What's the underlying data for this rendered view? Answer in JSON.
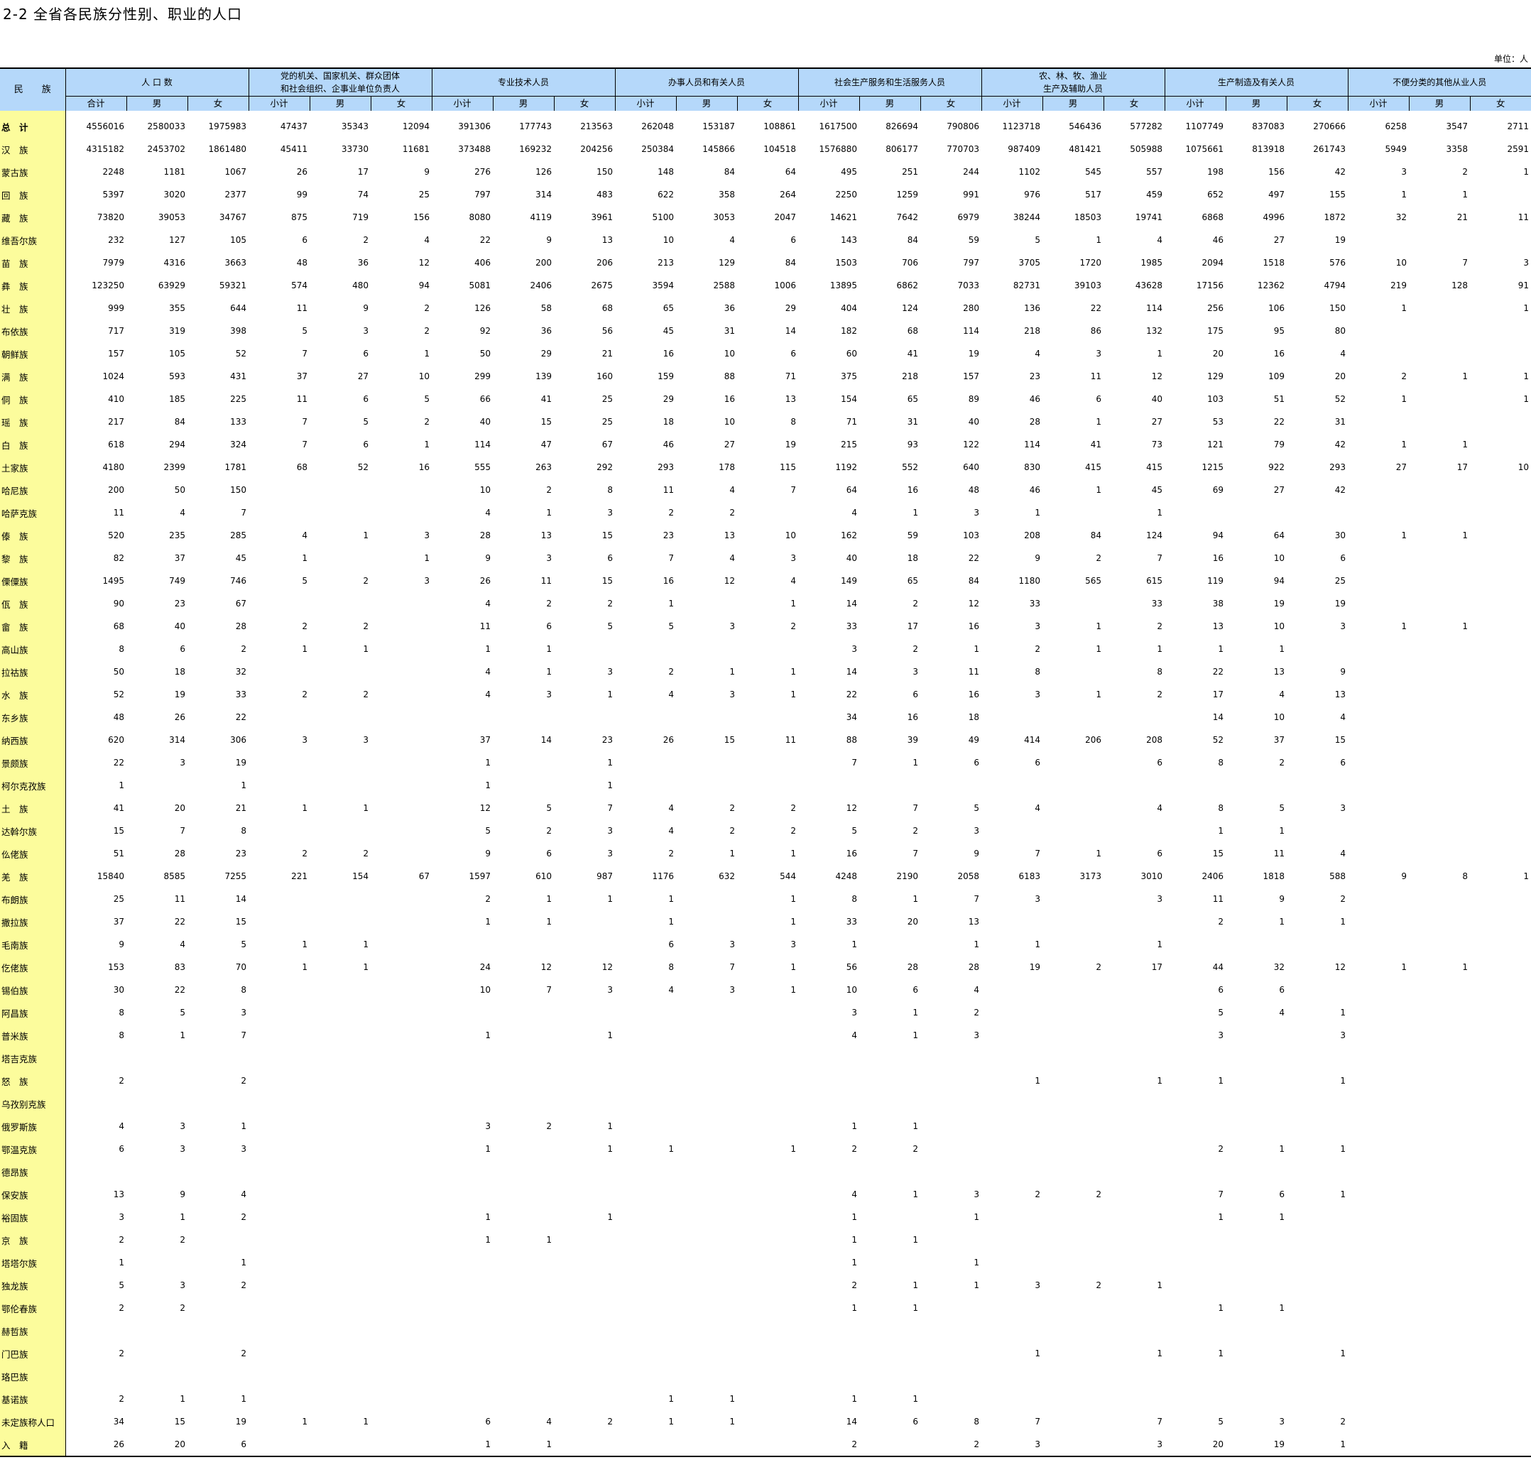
{
  "title": "2-2  全省各民族分性别、职业的人口",
  "unit": "单位：人",
  "header": {
    "row_label": "民　　族",
    "groups": [
      "人 口 数",
      "党的机关、国家机关、群众团体\n和社会组织、企事业单位负责人",
      "专业技术人员",
      "办事人员和有关人员",
      "社会生产服务和生活服务人员",
      "农、林、牧、渔业\n生产及辅助人员",
      "生产制造及有关人员",
      "不便分类的其他从业人员"
    ],
    "sub": [
      "合计",
      "男",
      "女",
      "小计",
      "男",
      "女",
      "小计",
      "男",
      "女",
      "小计",
      "男",
      "女",
      "小计",
      "男",
      "女",
      "小计",
      "男",
      "女",
      "小计",
      "男",
      "女",
      "小计",
      "男",
      "女"
    ]
  },
  "rows": [
    [
      "总　计",
      "4556016",
      "2580033",
      "1975983",
      "47437",
      "35343",
      "12094",
      "391306",
      "177743",
      "213563",
      "262048",
      "153187",
      "108861",
      "1617500",
      "826694",
      "790806",
      "1123718",
      "546436",
      "577282",
      "1107749",
      "837083",
      "270666",
      "6258",
      "3547",
      "2711"
    ],
    [
      "汉　族",
      "4315182",
      "2453702",
      "1861480",
      "45411",
      "33730",
      "11681",
      "373488",
      "169232",
      "204256",
      "250384",
      "145866",
      "104518",
      "1576880",
      "806177",
      "770703",
      "987409",
      "481421",
      "505988",
      "1075661",
      "813918",
      "261743",
      "5949",
      "3358",
      "2591"
    ],
    [
      "蒙古族",
      "2248",
      "1181",
      "1067",
      "26",
      "17",
      "9",
      "276",
      "126",
      "150",
      "148",
      "84",
      "64",
      "495",
      "251",
      "244",
      "1102",
      "545",
      "557",
      "198",
      "156",
      "42",
      "3",
      "2",
      "1"
    ],
    [
      "回　族",
      "5397",
      "3020",
      "2377",
      "99",
      "74",
      "25",
      "797",
      "314",
      "483",
      "622",
      "358",
      "264",
      "2250",
      "1259",
      "991",
      "976",
      "517",
      "459",
      "652",
      "497",
      "155",
      "1",
      "1",
      ""
    ],
    [
      "藏　族",
      "73820",
      "39053",
      "34767",
      "875",
      "719",
      "156",
      "8080",
      "4119",
      "3961",
      "5100",
      "3053",
      "2047",
      "14621",
      "7642",
      "6979",
      "38244",
      "18503",
      "19741",
      "6868",
      "4996",
      "1872",
      "32",
      "21",
      "11"
    ],
    [
      "维吾尔族",
      "232",
      "127",
      "105",
      "6",
      "2",
      "4",
      "22",
      "9",
      "13",
      "10",
      "4",
      "6",
      "143",
      "84",
      "59",
      "5",
      "1",
      "4",
      "46",
      "27",
      "19",
      "",
      "",
      ""
    ],
    [
      "苗　族",
      "7979",
      "4316",
      "3663",
      "48",
      "36",
      "12",
      "406",
      "200",
      "206",
      "213",
      "129",
      "84",
      "1503",
      "706",
      "797",
      "3705",
      "1720",
      "1985",
      "2094",
      "1518",
      "576",
      "10",
      "7",
      "3"
    ],
    [
      "彝　族",
      "123250",
      "63929",
      "59321",
      "574",
      "480",
      "94",
      "5081",
      "2406",
      "2675",
      "3594",
      "2588",
      "1006",
      "13895",
      "6862",
      "7033",
      "82731",
      "39103",
      "43628",
      "17156",
      "12362",
      "4794",
      "219",
      "128",
      "91"
    ],
    [
      "壮　族",
      "999",
      "355",
      "644",
      "11",
      "9",
      "2",
      "126",
      "58",
      "68",
      "65",
      "36",
      "29",
      "404",
      "124",
      "280",
      "136",
      "22",
      "114",
      "256",
      "106",
      "150",
      "1",
      "",
      "1"
    ],
    [
      "布依族",
      "717",
      "319",
      "398",
      "5",
      "3",
      "2",
      "92",
      "36",
      "56",
      "45",
      "31",
      "14",
      "182",
      "68",
      "114",
      "218",
      "86",
      "132",
      "175",
      "95",
      "80",
      "",
      "",
      ""
    ],
    [
      "朝鲜族",
      "157",
      "105",
      "52",
      "7",
      "6",
      "1",
      "50",
      "29",
      "21",
      "16",
      "10",
      "6",
      "60",
      "41",
      "19",
      "4",
      "3",
      "1",
      "20",
      "16",
      "4",
      "",
      "",
      ""
    ],
    [
      "满　族",
      "1024",
      "593",
      "431",
      "37",
      "27",
      "10",
      "299",
      "139",
      "160",
      "159",
      "88",
      "71",
      "375",
      "218",
      "157",
      "23",
      "11",
      "12",
      "129",
      "109",
      "20",
      "2",
      "1",
      "1"
    ],
    [
      "侗　族",
      "410",
      "185",
      "225",
      "11",
      "6",
      "5",
      "66",
      "41",
      "25",
      "29",
      "16",
      "13",
      "154",
      "65",
      "89",
      "46",
      "6",
      "40",
      "103",
      "51",
      "52",
      "1",
      "",
      "1"
    ],
    [
      "瑶　族",
      "217",
      "84",
      "133",
      "7",
      "5",
      "2",
      "40",
      "15",
      "25",
      "18",
      "10",
      "8",
      "71",
      "31",
      "40",
      "28",
      "1",
      "27",
      "53",
      "22",
      "31",
      "",
      "",
      ""
    ],
    [
      "白　族",
      "618",
      "294",
      "324",
      "7",
      "6",
      "1",
      "114",
      "47",
      "67",
      "46",
      "27",
      "19",
      "215",
      "93",
      "122",
      "114",
      "41",
      "73",
      "121",
      "79",
      "42",
      "1",
      "1",
      ""
    ],
    [
      "土家族",
      "4180",
      "2399",
      "1781",
      "68",
      "52",
      "16",
      "555",
      "263",
      "292",
      "293",
      "178",
      "115",
      "1192",
      "552",
      "640",
      "830",
      "415",
      "415",
      "1215",
      "922",
      "293",
      "27",
      "17",
      "10"
    ],
    [
      "哈尼族",
      "200",
      "50",
      "150",
      "",
      "",
      "",
      "10",
      "2",
      "8",
      "11",
      "4",
      "7",
      "64",
      "16",
      "48",
      "46",
      "1",
      "45",
      "69",
      "27",
      "42",
      "",
      "",
      ""
    ],
    [
      "哈萨克族",
      "11",
      "4",
      "7",
      "",
      "",
      "",
      "4",
      "1",
      "3",
      "2",
      "2",
      "",
      "4",
      "1",
      "3",
      "1",
      "",
      "1",
      "",
      "",
      "",
      "",
      "",
      ""
    ],
    [
      "傣　族",
      "520",
      "235",
      "285",
      "4",
      "1",
      "3",
      "28",
      "13",
      "15",
      "23",
      "13",
      "10",
      "162",
      "59",
      "103",
      "208",
      "84",
      "124",
      "94",
      "64",
      "30",
      "1",
      "1",
      ""
    ],
    [
      "黎　族",
      "82",
      "37",
      "45",
      "1",
      "",
      "1",
      "9",
      "3",
      "6",
      "7",
      "4",
      "3",
      "40",
      "18",
      "22",
      "9",
      "2",
      "7",
      "16",
      "10",
      "6",
      "",
      "",
      ""
    ],
    [
      "傈僳族",
      "1495",
      "749",
      "746",
      "5",
      "2",
      "3",
      "26",
      "11",
      "15",
      "16",
      "12",
      "4",
      "149",
      "65",
      "84",
      "1180",
      "565",
      "615",
      "119",
      "94",
      "25",
      "",
      "",
      ""
    ],
    [
      "佤　族",
      "90",
      "23",
      "67",
      "",
      "",
      "",
      "4",
      "2",
      "2",
      "1",
      "",
      "1",
      "14",
      "2",
      "12",
      "33",
      "",
      "33",
      "38",
      "19",
      "19",
      "",
      "",
      ""
    ],
    [
      "畲　族",
      "68",
      "40",
      "28",
      "2",
      "2",
      "",
      "11",
      "6",
      "5",
      "5",
      "3",
      "2",
      "33",
      "17",
      "16",
      "3",
      "1",
      "2",
      "13",
      "10",
      "3",
      "1",
      "1",
      ""
    ],
    [
      "高山族",
      "8",
      "6",
      "2",
      "1",
      "1",
      "",
      "1",
      "1",
      "",
      "",
      "",
      "",
      "3",
      "2",
      "1",
      "2",
      "1",
      "1",
      "1",
      "1",
      "",
      "",
      "",
      ""
    ],
    [
      "拉祜族",
      "50",
      "18",
      "32",
      "",
      "",
      "",
      "4",
      "1",
      "3",
      "2",
      "1",
      "1",
      "14",
      "3",
      "11",
      "8",
      "",
      "8",
      "22",
      "13",
      "9",
      "",
      "",
      ""
    ],
    [
      "水　族",
      "52",
      "19",
      "33",
      "2",
      "2",
      "",
      "4",
      "3",
      "1",
      "4",
      "3",
      "1",
      "22",
      "6",
      "16",
      "3",
      "1",
      "2",
      "17",
      "4",
      "13",
      "",
      "",
      ""
    ],
    [
      "东乡族",
      "48",
      "26",
      "22",
      "",
      "",
      "",
      "",
      "",
      "",
      "",
      "",
      "",
      "34",
      "16",
      "18",
      "",
      "",
      "",
      "14",
      "10",
      "4",
      "",
      "",
      ""
    ],
    [
      "纳西族",
      "620",
      "314",
      "306",
      "3",
      "3",
      "",
      "37",
      "14",
      "23",
      "26",
      "15",
      "11",
      "88",
      "39",
      "49",
      "414",
      "206",
      "208",
      "52",
      "37",
      "15",
      "",
      "",
      ""
    ],
    [
      "景颇族",
      "22",
      "3",
      "19",
      "",
      "",
      "",
      "1",
      "",
      "1",
      "",
      "",
      "",
      "7",
      "1",
      "6",
      "6",
      "",
      "6",
      "8",
      "2",
      "6",
      "",
      "",
      ""
    ],
    [
      "柯尔克孜族",
      "1",
      "",
      "1",
      "",
      "",
      "",
      "1",
      "",
      "1",
      "",
      "",
      "",
      "",
      "",
      "",
      "",
      "",
      "",
      "",
      "",
      "",
      "",
      "",
      ""
    ],
    [
      "土　族",
      "41",
      "20",
      "21",
      "1",
      "1",
      "",
      "12",
      "5",
      "7",
      "4",
      "2",
      "2",
      "12",
      "7",
      "5",
      "4",
      "",
      "4",
      "8",
      "5",
      "3",
      "",
      "",
      ""
    ],
    [
      "达斡尔族",
      "15",
      "7",
      "8",
      "",
      "",
      "",
      "5",
      "2",
      "3",
      "4",
      "2",
      "2",
      "5",
      "2",
      "3",
      "",
      "",
      "",
      "1",
      "1",
      "",
      "",
      "",
      ""
    ],
    [
      "仫佬族",
      "51",
      "28",
      "23",
      "2",
      "2",
      "",
      "9",
      "6",
      "3",
      "2",
      "1",
      "1",
      "16",
      "7",
      "9",
      "7",
      "1",
      "6",
      "15",
      "11",
      "4",
      "",
      "",
      ""
    ],
    [
      "羌　族",
      "15840",
      "8585",
      "7255",
      "221",
      "154",
      "67",
      "1597",
      "610",
      "987",
      "1176",
      "632",
      "544",
      "4248",
      "2190",
      "2058",
      "6183",
      "3173",
      "3010",
      "2406",
      "1818",
      "588",
      "9",
      "8",
      "1"
    ],
    [
      "布朗族",
      "25",
      "11",
      "14",
      "",
      "",
      "",
      "2",
      "1",
      "1",
      "1",
      "",
      "1",
      "8",
      "1",
      "7",
      "3",
      "",
      "3",
      "11",
      "9",
      "2",
      "",
      "",
      ""
    ],
    [
      "撒拉族",
      "37",
      "22",
      "15",
      "",
      "",
      "",
      "1",
      "1",
      "",
      "1",
      "",
      "1",
      "33",
      "20",
      "13",
      "",
      "",
      "",
      "2",
      "1",
      "1",
      "",
      "",
      ""
    ],
    [
      "毛南族",
      "9",
      "4",
      "5",
      "1",
      "1",
      "",
      "",
      "",
      "",
      "6",
      "3",
      "3",
      "1",
      "",
      "1",
      "1",
      "",
      "1",
      "",
      "",
      "",
      "",
      "",
      ""
    ],
    [
      "仡佬族",
      "153",
      "83",
      "70",
      "1",
      "1",
      "",
      "24",
      "12",
      "12",
      "8",
      "7",
      "1",
      "56",
      "28",
      "28",
      "19",
      "2",
      "17",
      "44",
      "32",
      "12",
      "1",
      "1",
      ""
    ],
    [
      "锡伯族",
      "30",
      "22",
      "8",
      "",
      "",
      "",
      "10",
      "7",
      "3",
      "4",
      "3",
      "1",
      "10",
      "6",
      "4",
      "",
      "",
      "",
      "6",
      "6",
      "",
      "",
      "",
      ""
    ],
    [
      "阿昌族",
      "8",
      "5",
      "3",
      "",
      "",
      "",
      "",
      "",
      "",
      "",
      "",
      "",
      "3",
      "1",
      "2",
      "",
      "",
      "",
      "5",
      "4",
      "1",
      "",
      "",
      ""
    ],
    [
      "普米族",
      "8",
      "1",
      "7",
      "",
      "",
      "",
      "1",
      "",
      "1",
      "",
      "",
      "",
      "4",
      "1",
      "3",
      "",
      "",
      "",
      "3",
      "",
      "3",
      "",
      "",
      ""
    ],
    [
      "塔吉克族",
      "",
      "",
      "",
      "",
      "",
      "",
      "",
      "",
      "",
      "",
      "",
      "",
      "",
      "",
      "",
      "",
      "",
      "",
      "",
      "",
      "",
      "",
      "",
      ""
    ],
    [
      "怒　族",
      "2",
      "",
      "2",
      "",
      "",
      "",
      "",
      "",
      "",
      "",
      "",
      "",
      "",
      "",
      "",
      "1",
      "",
      "1",
      "1",
      "",
      "1",
      "",
      "",
      ""
    ],
    [
      "乌孜别克族",
      "",
      "",
      "",
      "",
      "",
      "",
      "",
      "",
      "",
      "",
      "",
      "",
      "",
      "",
      "",
      "",
      "",
      "",
      "",
      "",
      "",
      "",
      "",
      ""
    ],
    [
      "俄罗斯族",
      "4",
      "3",
      "1",
      "",
      "",
      "",
      "3",
      "2",
      "1",
      "",
      "",
      "",
      "1",
      "1",
      "",
      "",
      "",
      "",
      "",
      "",
      "",
      "",
      "",
      ""
    ],
    [
      "鄂温克族",
      "6",
      "3",
      "3",
      "",
      "",
      "",
      "1",
      "",
      "1",
      "1",
      "",
      "1",
      "2",
      "2",
      "",
      "",
      "",
      "",
      "2",
      "1",
      "1",
      "",
      "",
      ""
    ],
    [
      "德昂族",
      "",
      "",
      "",
      "",
      "",
      "",
      "",
      "",
      "",
      "",
      "",
      "",
      "",
      "",
      "",
      "",
      "",
      "",
      "",
      "",
      "",
      "",
      "",
      ""
    ],
    [
      "保安族",
      "13",
      "9",
      "4",
      "",
      "",
      "",
      "",
      "",
      "",
      "",
      "",
      "",
      "4",
      "1",
      "3",
      "2",
      "2",
      "",
      "7",
      "6",
      "1",
      "",
      "",
      ""
    ],
    [
      "裕固族",
      "3",
      "1",
      "2",
      "",
      "",
      "",
      "1",
      "",
      "1",
      "",
      "",
      "",
      "1",
      "",
      "1",
      "",
      "",
      "",
      "1",
      "1",
      "",
      "",
      "",
      ""
    ],
    [
      "京　族",
      "2",
      "2",
      "",
      "",
      "",
      "",
      "1",
      "1",
      "",
      "",
      "",
      "",
      "1",
      "1",
      "",
      "",
      "",
      "",
      "",
      "",
      "",
      "",
      "",
      ""
    ],
    [
      "塔塔尔族",
      "1",
      "",
      "1",
      "",
      "",
      "",
      "",
      "",
      "",
      "",
      "",
      "",
      "1",
      "",
      "1",
      "",
      "",
      "",
      "",
      "",
      "",
      "",
      "",
      ""
    ],
    [
      "独龙族",
      "5",
      "3",
      "2",
      "",
      "",
      "",
      "",
      "",
      "",
      "",
      "",
      "",
      "2",
      "1",
      "1",
      "3",
      "2",
      "1",
      "",
      "",
      "",
      "",
      "",
      ""
    ],
    [
      "鄂伦春族",
      "2",
      "2",
      "",
      "",
      "",
      "",
      "",
      "",
      "",
      "",
      "",
      "",
      "1",
      "1",
      "",
      "",
      "",
      "",
      "1",
      "1",
      "",
      "",
      "",
      ""
    ],
    [
      "赫哲族",
      "",
      "",
      "",
      "",
      "",
      "",
      "",
      "",
      "",
      "",
      "",
      "",
      "",
      "",
      "",
      "",
      "",
      "",
      "",
      "",
      "",
      "",
      "",
      ""
    ],
    [
      "门巴族",
      "2",
      "",
      "2",
      "",
      "",
      "",
      "",
      "",
      "",
      "",
      "",
      "",
      "",
      "",
      "",
      "1",
      "",
      "1",
      "1",
      "",
      "1",
      "",
      "",
      ""
    ],
    [
      "珞巴族",
      "",
      "",
      "",
      "",
      "",
      "",
      "",
      "",
      "",
      "",
      "",
      "",
      "",
      "",
      "",
      "",
      "",
      "",
      "",
      "",
      "",
      "",
      "",
      ""
    ],
    [
      "基诺族",
      "2",
      "1",
      "1",
      "",
      "",
      "",
      "",
      "",
      "",
      "1",
      "1",
      "",
      "1",
      "1",
      "",
      "",
      "",
      "",
      "",
      "",
      "",
      "",
      "",
      ""
    ],
    [
      "未定族称人口",
      "34",
      "15",
      "19",
      "1",
      "1",
      "",
      "6",
      "4",
      "2",
      "1",
      "1",
      "",
      "14",
      "6",
      "8",
      "7",
      "",
      "7",
      "5",
      "3",
      "2",
      "",
      "",
      ""
    ],
    [
      "入　籍",
      "26",
      "20",
      "6",
      "",
      "",
      "",
      "1",
      "1",
      "",
      "",
      "",
      "",
      "2",
      "",
      "2",
      "3",
      "",
      "3",
      "20",
      "19",
      "1",
      "",
      "",
      ""
    ]
  ]
}
